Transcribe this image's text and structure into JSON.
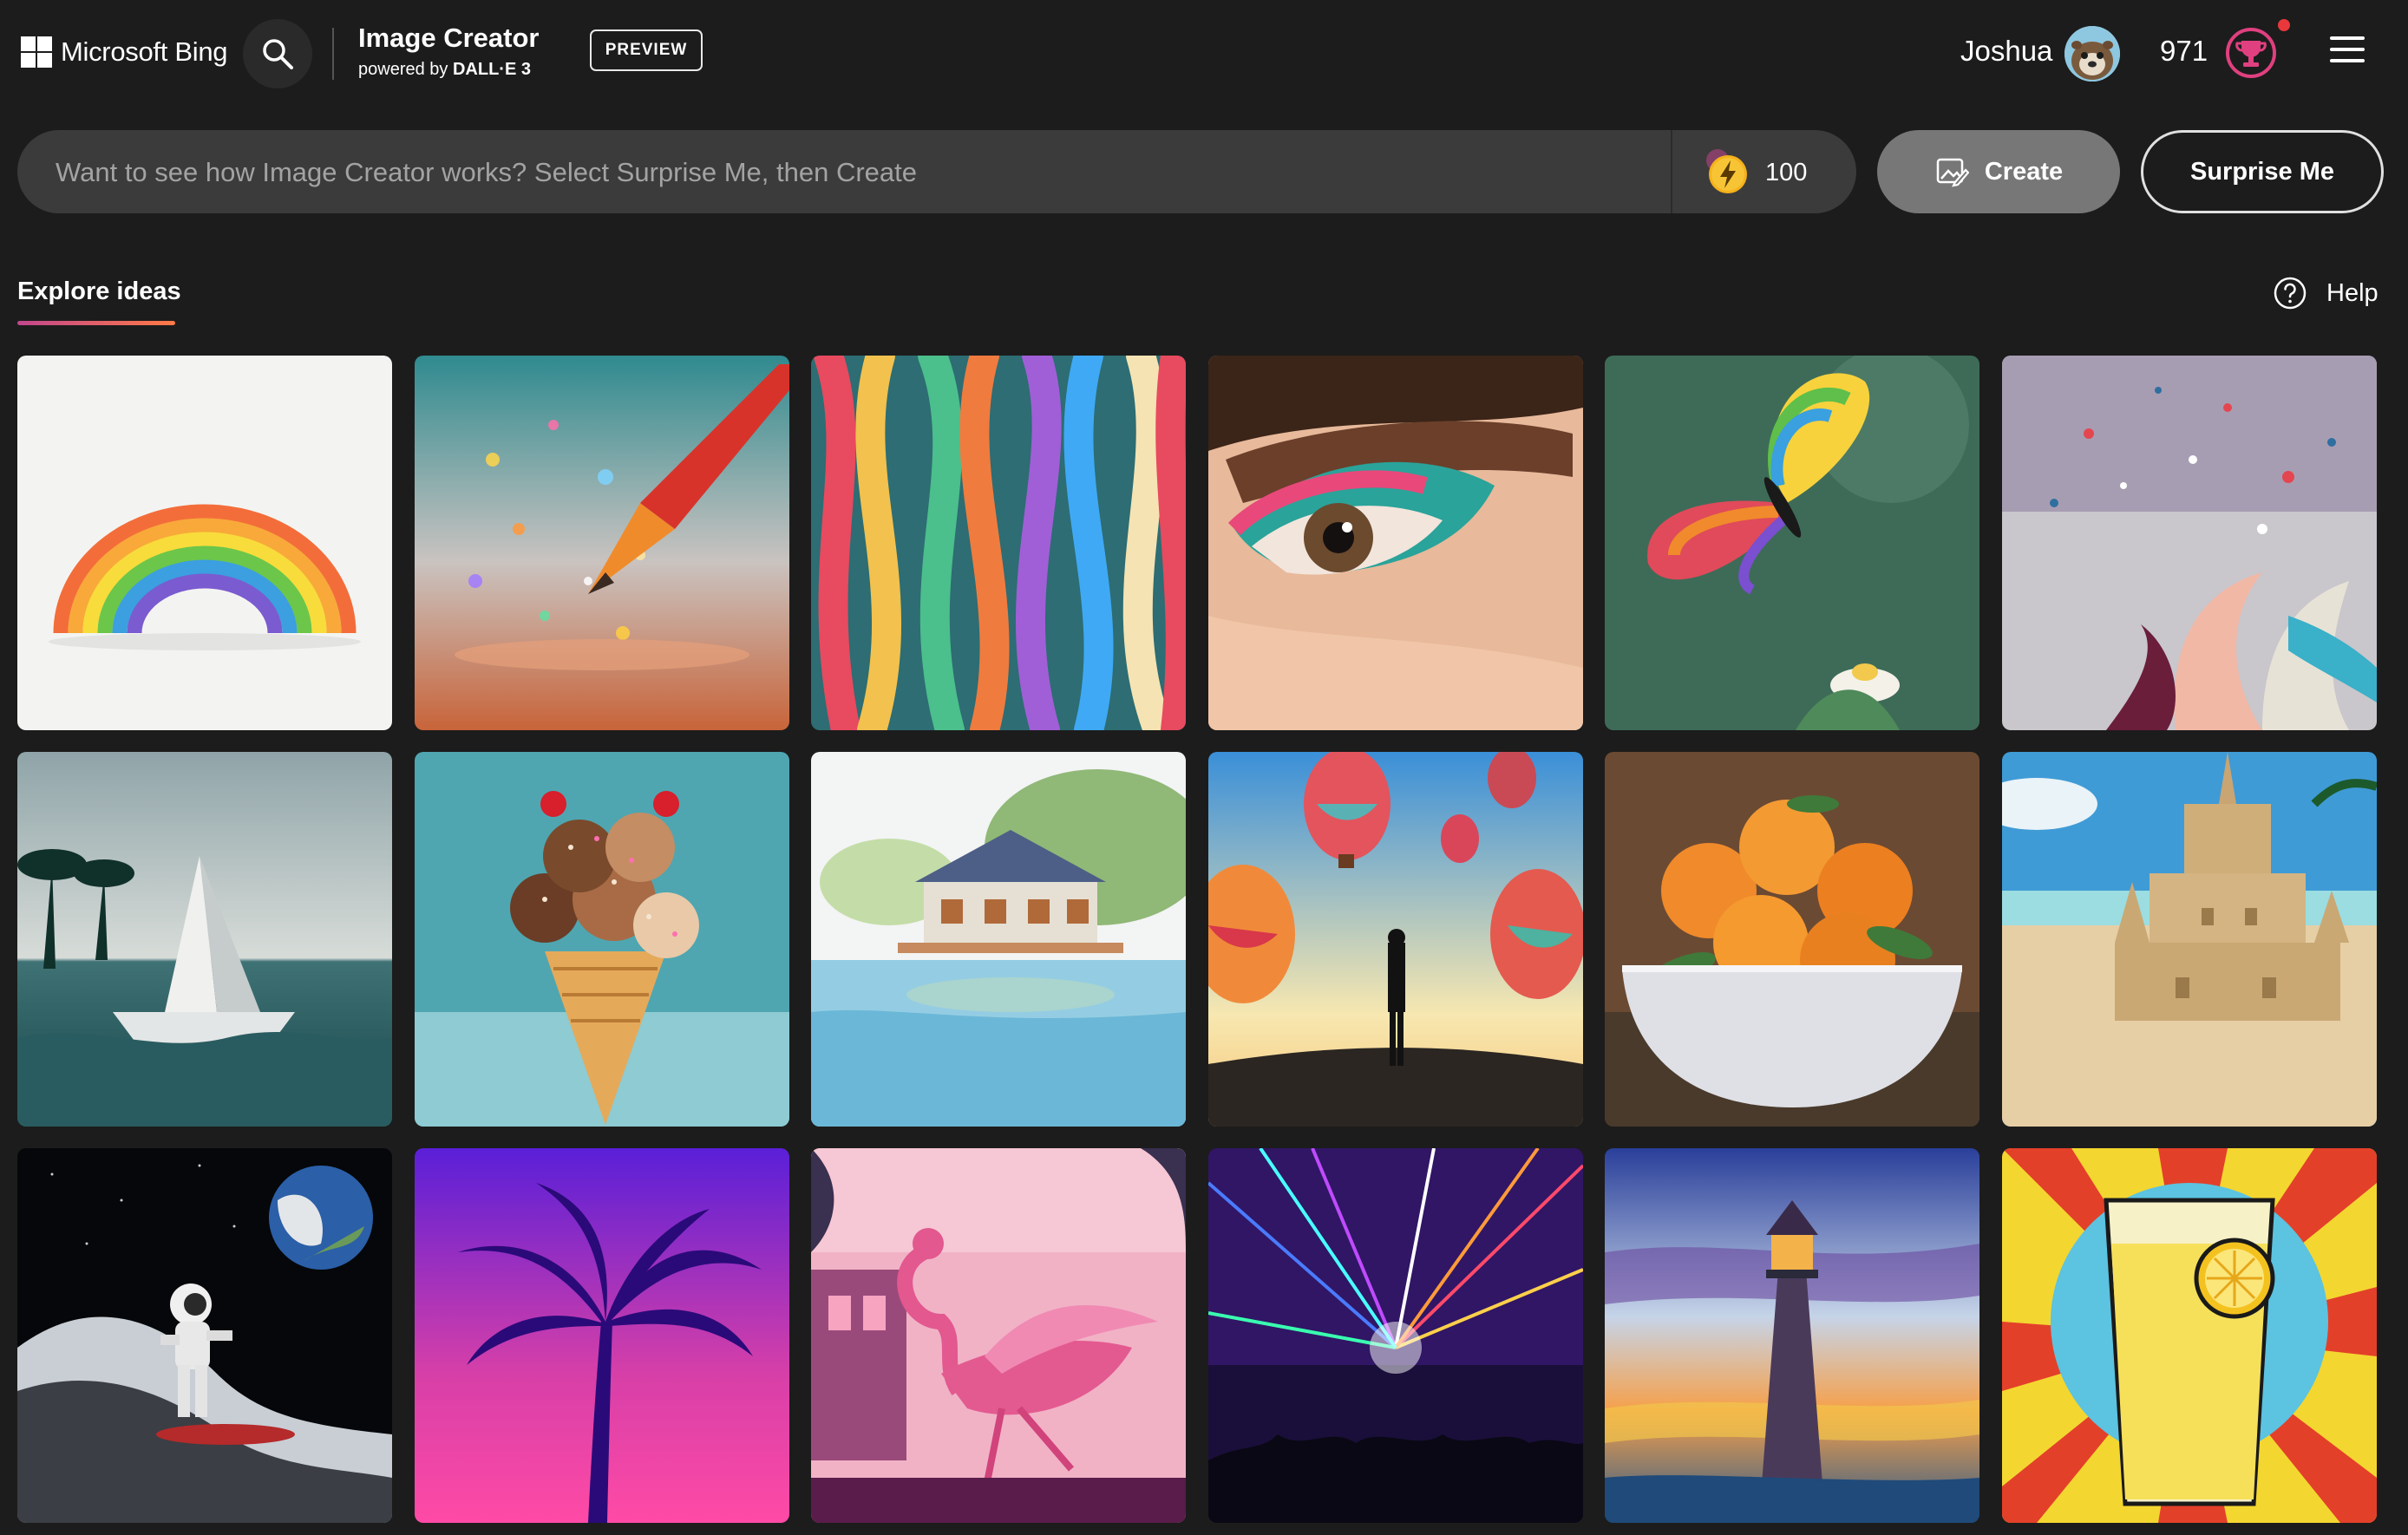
{
  "header": {
    "logo_text": "Microsoft Bing",
    "app_title": "Image Creator",
    "powered_prefix": "powered by",
    "powered_brand": "DALL·E 3",
    "preview_badge": "PREVIEW",
    "user_name": "Joshua",
    "points": "971"
  },
  "prompt": {
    "placeholder": "Want to see how Image Creator works? Select Surprise Me, then Create",
    "value": "",
    "boosts": "100"
  },
  "buttons": {
    "create": "Create",
    "surprise": "Surprise Me"
  },
  "section": {
    "tab_label": "Explore ideas",
    "help_label": "Help"
  },
  "colors": {
    "background": "#1c1c1c",
    "prompt_bg": "#3b3b3b",
    "create_bg": "#777777",
    "accent_start": "#c2468d",
    "accent_end": "#ff7a45",
    "reward_pink": "#e0407f",
    "boost_gold": "#f5b21b"
  },
  "icons": {
    "ms_logo": "microsoft-logo-icon",
    "search": "search-icon",
    "boost": "lightning-coin-icon",
    "create": "image-create-icon",
    "help": "help-circle-icon",
    "reward": "trophy-rewards-icon",
    "menu": "hamburger-menu-icon"
  },
  "ideas": [
    "paper-rainbow",
    "glitter-pencil",
    "colorful-ribbons",
    "eye-makeup",
    "rainbow-butterfly",
    "paint-splash",
    "paper-boat-sea",
    "ice-cream-cone",
    "watercolor-lake-house",
    "hot-air-balloons",
    "oranges-bowl",
    "sand-castle",
    "astronaut-surfing",
    "vaporwave-palm",
    "pink-flamingo",
    "laser-concert",
    "pointillist-lighthouse",
    "pop-art-lemonade"
  ]
}
